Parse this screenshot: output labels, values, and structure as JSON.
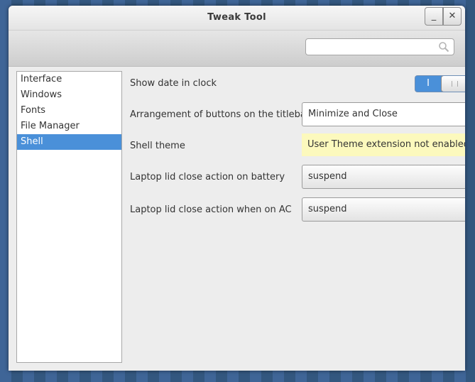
{
  "window": {
    "title": "Tweak Tool",
    "minimize_label": "_",
    "close_label": "✕"
  },
  "search": {
    "value": "",
    "placeholder": "",
    "icon": "search-icon"
  },
  "sidebar": {
    "items": [
      {
        "label": "Interface",
        "selected": false
      },
      {
        "label": "Windows",
        "selected": false
      },
      {
        "label": "Fonts",
        "selected": false
      },
      {
        "label": "File Manager",
        "selected": false
      },
      {
        "label": "Shell",
        "selected": true
      }
    ],
    "selected_color": "#4a90d9"
  },
  "settings": {
    "show_date": {
      "label": "Show date in clock",
      "switch_on_label": "I",
      "enabled": true
    },
    "button_arrangement": {
      "label": "Arrangement of buttons on the titlebar",
      "value": "Minimize and Close"
    },
    "shell_theme": {
      "label": "Shell theme",
      "message": "User Theme extension not enabled"
    },
    "lid_battery": {
      "label": "Laptop lid close action on battery",
      "value": "suspend"
    },
    "lid_ac": {
      "label": "Laptop lid close action when on AC",
      "value": "suspend"
    }
  },
  "colors": {
    "accent": "#4a90d9",
    "warning_background": "#fcf9bd",
    "desktop_background": "#3f6597"
  }
}
